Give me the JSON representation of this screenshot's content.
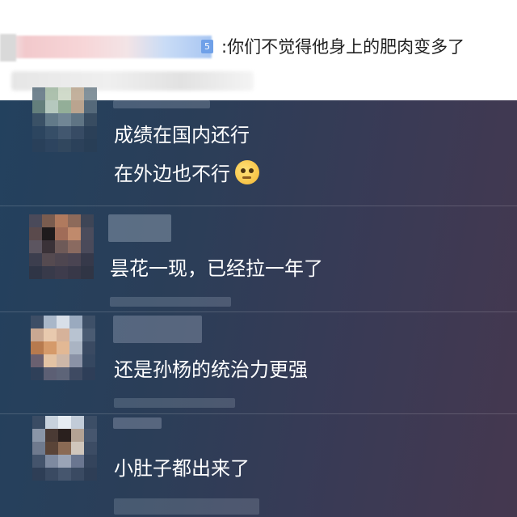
{
  "top_comment": {
    "level": "5",
    "text": ":你们不觉得他身上的肥肉变多了"
  },
  "replies": [
    {
      "lines": [
        "成绩在国内还行",
        "在外边也不行"
      ],
      "emoji": "thinking-face-icon"
    },
    {
      "lines": [
        "昙花一现，已经拉一年了"
      ]
    },
    {
      "lines": [
        "还是孙杨的统治力更强"
      ]
    },
    {
      "lines": [
        "小肚子都出来了"
      ]
    }
  ]
}
